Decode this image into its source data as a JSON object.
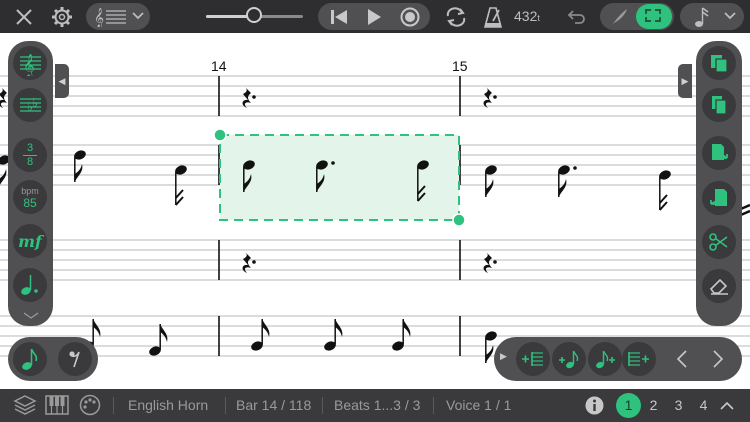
{
  "toolbar": {
    "tempo_value": "432",
    "tempo_suffix": "t"
  },
  "score": {
    "bar_numbers": [
      "14",
      "15"
    ]
  },
  "left_panel": {
    "time_sig_top": "3",
    "time_sig_bottom": "8",
    "bpm_label": "bpm",
    "bpm_value": "85",
    "dynamic": "mf"
  },
  "status": {
    "instrument": "English Horn",
    "bar": "Bar 14 / 118",
    "beats": "Beats 1...3 / 3",
    "voice": "Voice 1 / 1",
    "voices": [
      "1",
      "2",
      "3",
      "4"
    ],
    "active_voice": "1"
  },
  "colors": {
    "accent": "#2ec27e",
    "toolbar_bg": "#2e2e30",
    "panel_bg": "#505052",
    "selection_fill": "#e3f4ea"
  }
}
